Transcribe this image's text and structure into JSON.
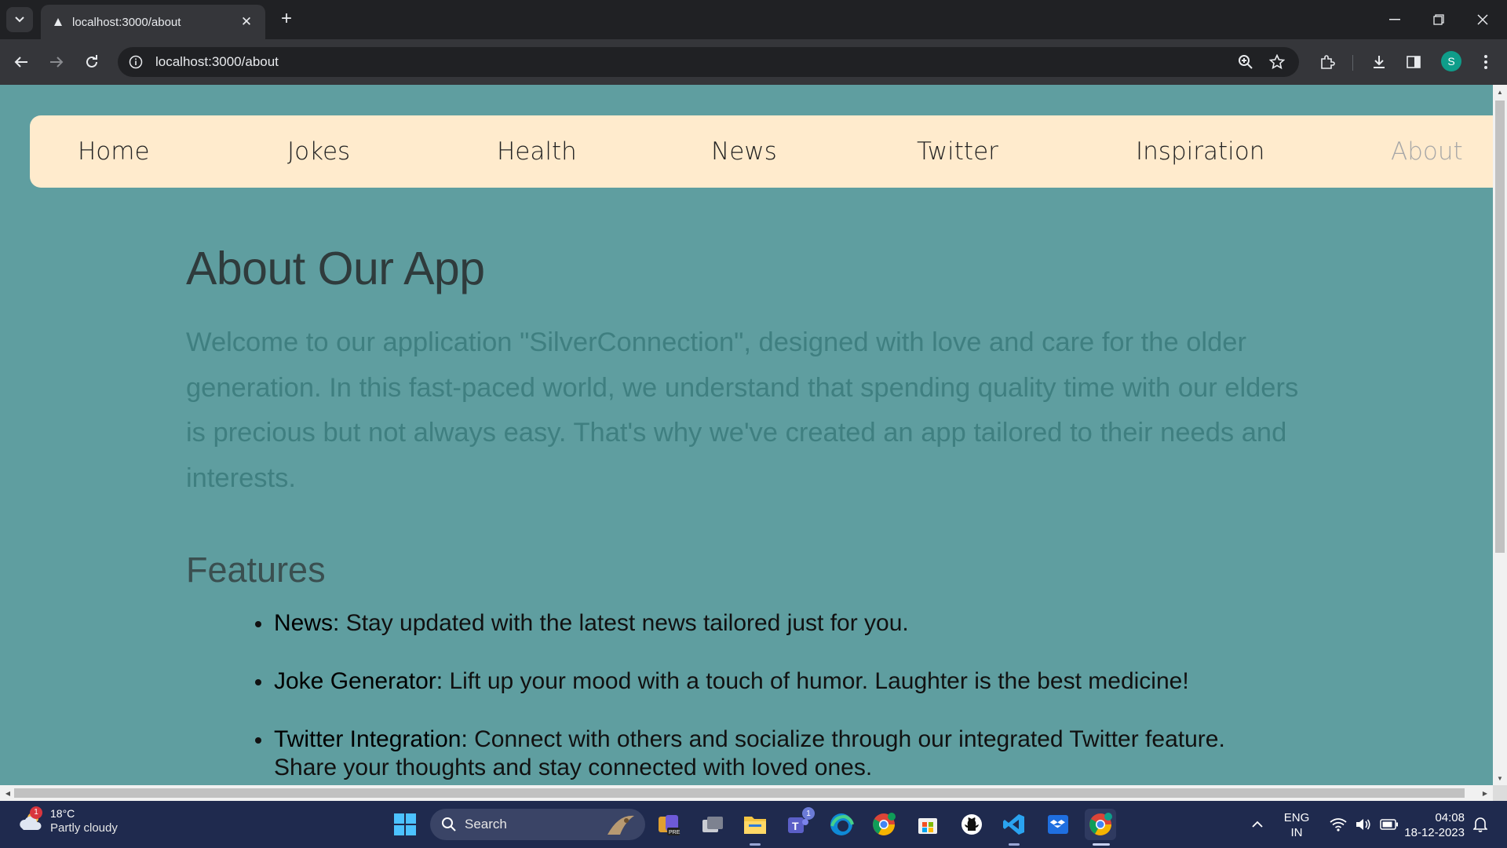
{
  "browser": {
    "tab_title": "localhost:3000/about",
    "url": "localhost:3000/about",
    "profile_initial": "S"
  },
  "navbar": {
    "items": [
      {
        "label": "Home"
      },
      {
        "label": "Jokes"
      },
      {
        "label": "Health"
      },
      {
        "label": "News"
      },
      {
        "label": "Twitter"
      },
      {
        "label": "Inspiration"
      },
      {
        "label": "About"
      }
    ],
    "active": "About"
  },
  "page": {
    "title": "About Our App",
    "intro": "Welcome to our application \"SilverConnection\", designed with love and care for the older generation. In this fast-paced world, we understand that spending quality time with our elders is precious but not always easy. That's why we've created an app tailored to their needs and interests.",
    "features_title": "Features",
    "features": [
      {
        "name": "News:",
        "text": " Stay updated with the latest news tailored just for you."
      },
      {
        "name": "Joke Generator:",
        "text": " Lift up your mood with a touch of humor. Laughter is the best medicine!"
      },
      {
        "name": "Twitter Integration:",
        "text": " Connect with others and socialize through our integrated Twitter feature. Share your thoughts and stay connected with loved ones."
      }
    ]
  },
  "taskbar": {
    "weather_temp": "18°C",
    "weather_cond": "Partly cloudy",
    "weather_badge": "1",
    "search_label": "Search",
    "teams_badge": "1",
    "lang_line1": "ENG",
    "lang_line2": "IN",
    "time": "04:08",
    "date": "18-12-2023"
  },
  "colors": {
    "page_bg": "#5f9ea0",
    "navbar_bg": "#ffebcd",
    "taskbar_bg": "#1f2a4e"
  }
}
